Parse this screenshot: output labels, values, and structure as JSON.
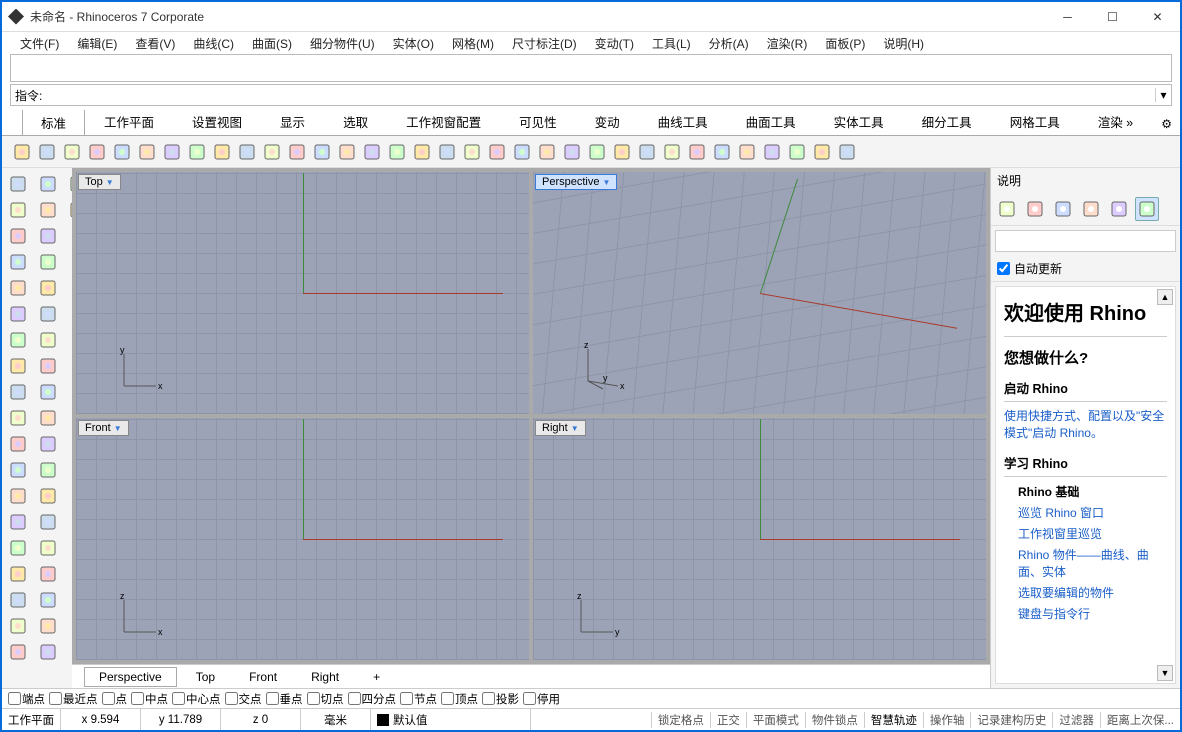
{
  "window": {
    "title": "未命名 - Rhinoceros 7 Corporate"
  },
  "menu": [
    "文件(F)",
    "编辑(E)",
    "查看(V)",
    "曲线(C)",
    "曲面(S)",
    "细分物件(U)",
    "实体(O)",
    "网格(M)",
    "尺寸标注(D)",
    "变动(T)",
    "工具(L)",
    "分析(A)",
    "渲染(R)",
    "面板(P)",
    "说明(H)"
  ],
  "command_prompt": "指令:",
  "tabs": [
    "标准",
    "工作平面",
    "设置视图",
    "显示",
    "选取",
    "工作视窗配置",
    "可见性",
    "变动",
    "曲线工具",
    "曲面工具",
    "实体工具",
    "细分工具",
    "网格工具"
  ],
  "tabs_overflow": "渲染",
  "toolbar_top": [
    "new",
    "open",
    "save",
    "print",
    "prefs",
    "cut",
    "copy",
    "paste",
    "undo",
    "redo",
    "pan",
    "rotate",
    "zoom-sel",
    "zoom-ext",
    "zoom-win",
    "zoom",
    "maximize",
    "4view",
    "car",
    "fly",
    "sun",
    "measure",
    "light",
    "sphere",
    "book1",
    "globe",
    "planet",
    "ball1",
    "ball2",
    "layers",
    "gear",
    "user",
    "earth",
    "help"
  ],
  "toolbar_left": [
    "pointer",
    "lasso",
    "line",
    "polyline",
    "circle",
    "ellipse",
    "arc",
    "rect",
    "curve",
    "freeform",
    "polygon",
    "star",
    "spiral",
    "pipe",
    "box",
    "cylinder",
    "sphere",
    "cone",
    "sweep",
    "explode",
    "star-burst",
    "bend",
    "twist",
    "text",
    "dim",
    "hatch",
    "move",
    "rotate2",
    "scale",
    "mirror",
    "array",
    "trim",
    "split",
    "join",
    "group",
    "ungroup",
    "layer",
    "hide",
    "lock",
    "render"
  ],
  "viewports": {
    "top": "Top",
    "persp": "Perspective",
    "front": "Front",
    "right": "Right"
  },
  "vp_axes": {
    "x": "x",
    "y": "y",
    "z": "z"
  },
  "viewport_tabs": [
    "Perspective",
    "Top",
    "Front",
    "Right"
  ],
  "vp_add": "+",
  "right_panel": {
    "title": "说明",
    "icons": [
      "globe",
      "book",
      "saturn",
      "eyedrop",
      "folder",
      "help-active"
    ],
    "auto_update": "自动更新",
    "help": {
      "h1": "欢迎使用 Rhino",
      "h2": "您想做什么?",
      "h3a": "启动 Rhino",
      "link_a": "使用快捷方式、配置以及\"安全模式\"启动 Rhino。",
      "h3b": "学习 Rhino",
      "sec_b": "Rhino 基础",
      "links_b": [
        "巡览 Rhino 窗口",
        "工作视窗里巡览",
        "Rhino 物件——曲线、曲面、实体",
        "选取要编辑的物件",
        "键盘与指令行"
      ]
    }
  },
  "osnap": [
    "端点",
    "最近点",
    "点",
    "中点",
    "中心点",
    "交点",
    "垂点",
    "切点",
    "四分点",
    "节点",
    "顶点",
    "投影",
    "停用"
  ],
  "status": {
    "cplane": "工作平面",
    "x": "x 9.594",
    "y": "y 11.789",
    "z": "z 0",
    "unit": "毫米",
    "layer": "默认值",
    "toggles": [
      "锁定格点",
      "正交",
      "平面模式",
      "物件锁点",
      "智慧轨迹",
      "操作轴",
      "记录建构历史",
      "过滤器",
      "距离上次保..."
    ],
    "active_idx": 4
  }
}
